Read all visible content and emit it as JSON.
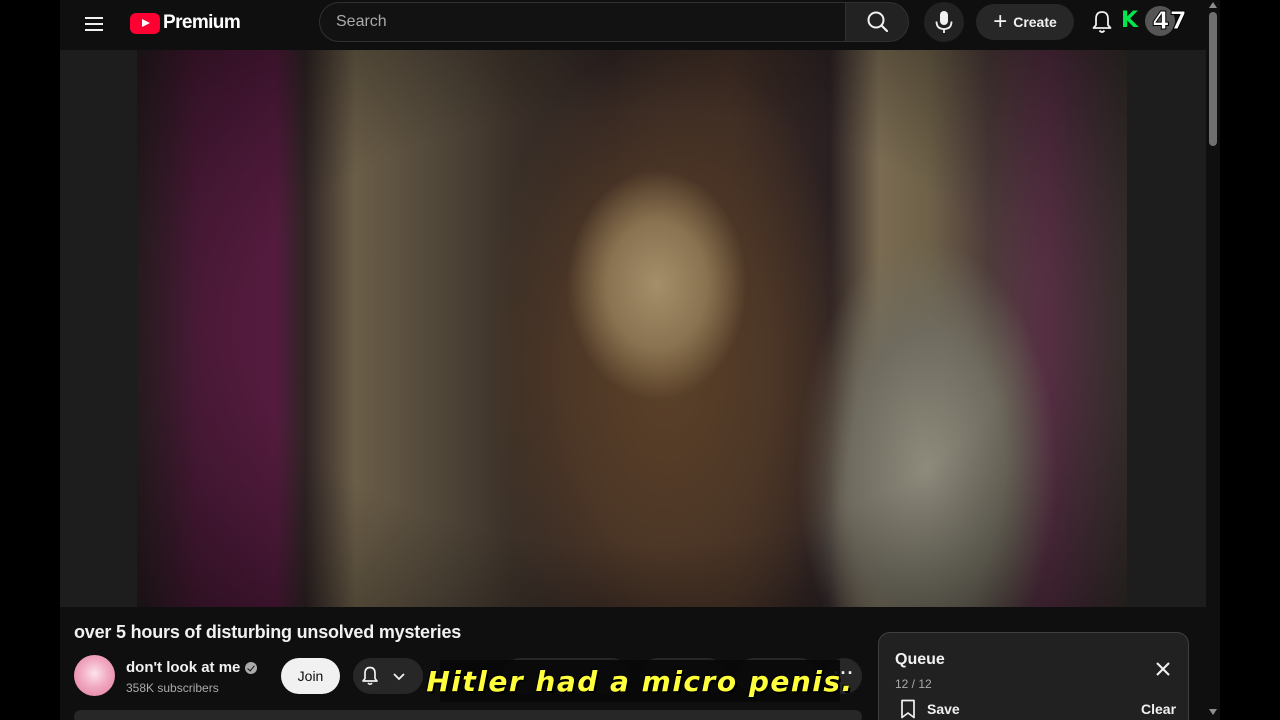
{
  "header": {
    "logo_text": "Premium",
    "search_placeholder": "Search",
    "create_label": "Create",
    "badge_letter": "K",
    "badge_number": "47"
  },
  "icons": {
    "menu": "menu-icon",
    "search": "search-icon",
    "mic": "mic-icon",
    "create": "plus-icon",
    "notifications": "bell-icon",
    "verified": "verified-icon",
    "subscribe_bell": "bell-icon",
    "dropdown": "chevron-down-icon",
    "more": "more-horizontal-icon",
    "close": "close-icon",
    "save": "bookmark-icon"
  },
  "video": {
    "title": "over 5 hours of disturbing unsolved mysteries",
    "caption": "Hitler had a micro penis."
  },
  "channel": {
    "name": "don't look at me",
    "subscribers": "358K subscribers",
    "join_label": "Join"
  },
  "queue": {
    "title": "Queue",
    "count": "12 / 12",
    "save_label": "Save",
    "clear_label": "Clear"
  },
  "colors": {
    "background": "#0f0f0f",
    "brand_red": "#ff0033",
    "caption_text": "#ffff3c",
    "badge_green": "#00e64d"
  }
}
